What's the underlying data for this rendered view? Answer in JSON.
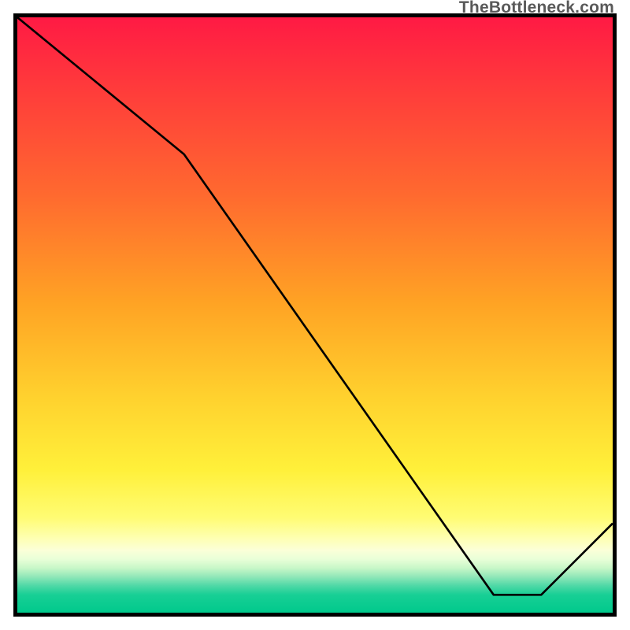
{
  "watermark": "TheBottleneck.com",
  "bottom_label": "",
  "chart_data": {
    "type": "line",
    "title": "",
    "xlabel": "",
    "ylabel": "",
    "xlim": [
      0,
      100
    ],
    "ylim": [
      0,
      100
    ],
    "x": [
      0,
      28,
      80,
      88,
      100
    ],
    "values": [
      100,
      77,
      3,
      3,
      15
    ],
    "annotations": [
      {
        "text": "",
        "x": 83,
        "y": 4
      }
    ],
    "background_gradient": {
      "direction": "vertical",
      "stops": [
        {
          "pos": 0.0,
          "color": "#ff1a44"
        },
        {
          "pos": 0.3,
          "color": "#ff6a2f"
        },
        {
          "pos": 0.64,
          "color": "#ffd22e"
        },
        {
          "pos": 0.88,
          "color": "#feffb2"
        },
        {
          "pos": 0.95,
          "color": "#4ed8a6"
        },
        {
          "pos": 1.0,
          "color": "#00c98c"
        }
      ]
    }
  }
}
